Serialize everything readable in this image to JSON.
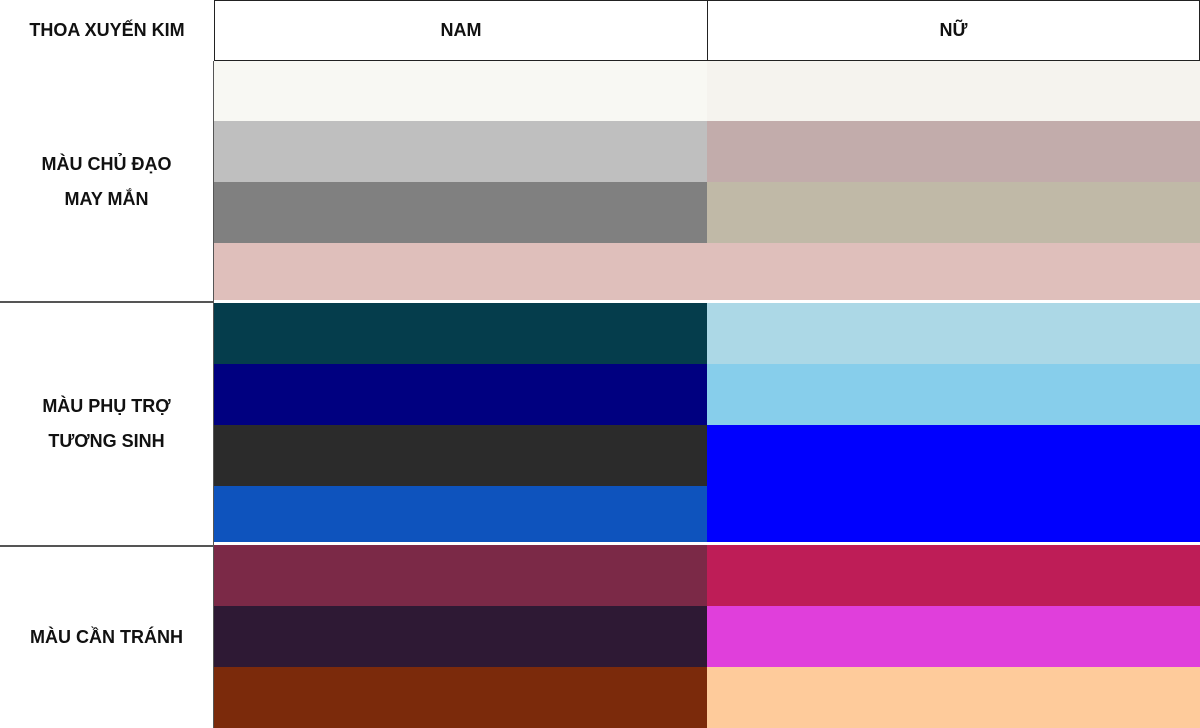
{
  "header": {
    "corner_label": "THOA XUYẾN KIM",
    "col_nam": "NAM",
    "col_nu": "NỮ"
  },
  "groups": [
    {
      "line1": "MÀU CHỦ ĐẠO",
      "line2": "MAY MẮN",
      "nam_colors": [
        "#f8f8f3",
        "#bfbfbf",
        "#808080",
        "#dfbfbb"
      ],
      "nu_colors": [
        "#f5f3ee",
        "#c2acab",
        "#c0b9a7",
        "#dfbfbb"
      ]
    },
    {
      "line1": "MÀU PHỤ TRỢ",
      "line2": "TƯƠNG SINH",
      "nam_colors": [
        "#053d4c",
        "#000080",
        "#2b2b2b",
        "#0e53bd"
      ],
      "nu_colors": [
        "#acd8e6",
        "#87ceeb",
        "#0000fe",
        "#0000fe"
      ]
    },
    {
      "line1": "MÀU CẦN TRÁNH",
      "line2": "",
      "nam_colors": [
        "#7b2947",
        "#2e1934",
        "#7b2a0b"
      ],
      "nu_colors": [
        "#be1d57",
        "#e03fdb",
        "#fecb9b"
      ]
    }
  ]
}
